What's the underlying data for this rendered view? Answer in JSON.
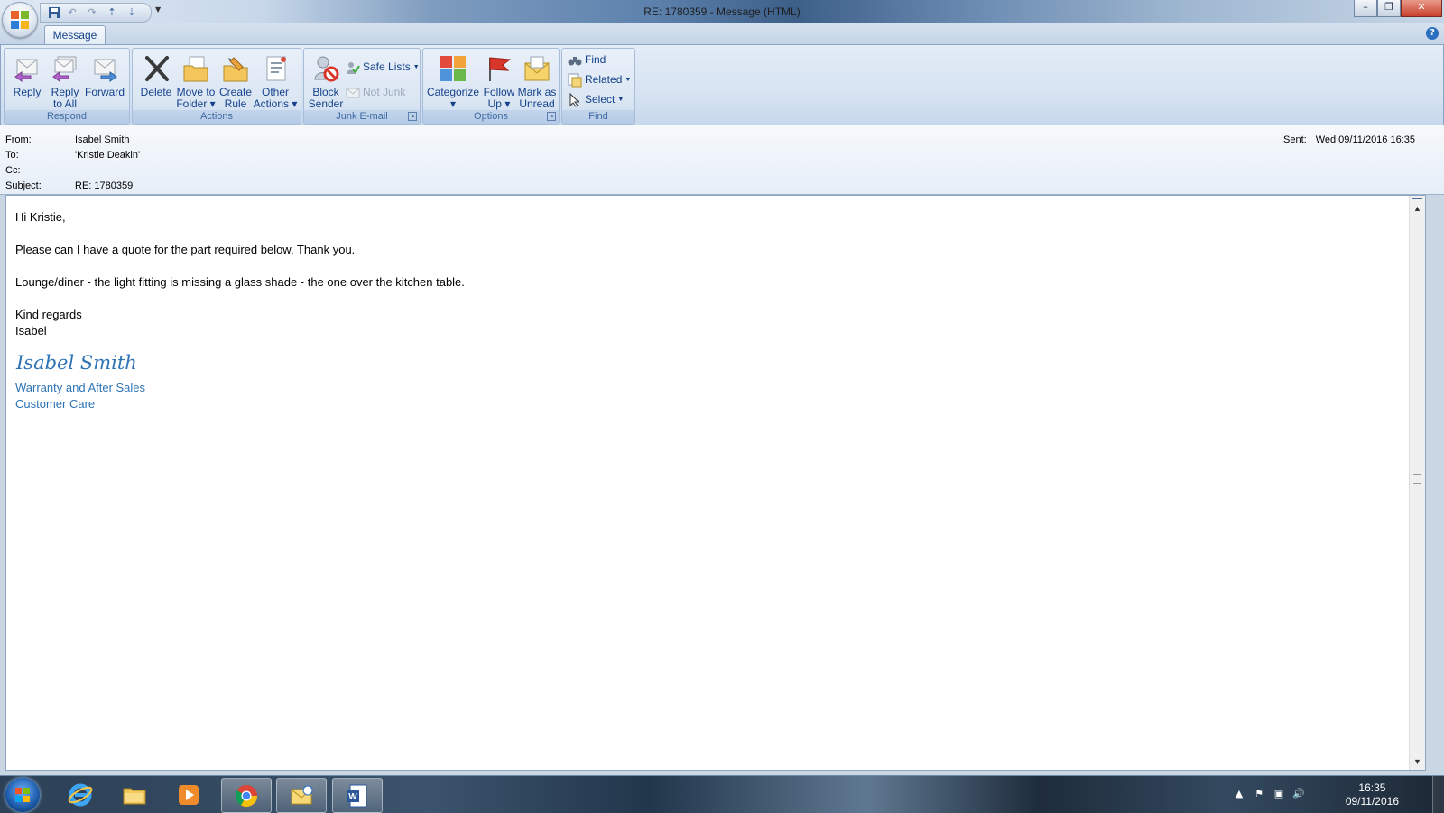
{
  "window": {
    "title": "RE: 1780359  -  Message (HTML)",
    "controls": [
      "–",
      "❐",
      "✕"
    ]
  },
  "ribbon": {
    "tab": "Message",
    "groups": {
      "respond": {
        "label": "Respond",
        "reply": "Reply",
        "reply_all": "Reply\nto All",
        "forward": "Forward"
      },
      "actions": {
        "label": "Actions",
        "delete": "Delete",
        "move_to_folder": "Move to\nFolder ▾",
        "create_rule": "Create\nRule",
        "other_actions": "Other\nActions ▾"
      },
      "junk": {
        "label": "Junk E-mail",
        "block_sender": "Block\nSender",
        "safe_lists": "Safe Lists",
        "not_junk": "Not Junk"
      },
      "options": {
        "label": "Options",
        "categorize": "Categorize\n▾",
        "follow_up": "Follow\nUp ▾",
        "mark_unread": "Mark as\nUnread"
      },
      "find": {
        "label": "Find",
        "find": "Find",
        "related": "Related",
        "select": "Select"
      }
    }
  },
  "header": {
    "from_label": "From:",
    "from": "Isabel Smith",
    "to_label": "To:",
    "to": "'Kristie Deakin'",
    "cc_label": "Cc:",
    "cc": "",
    "subject_label": "Subject:",
    "subject": "RE: 1780359",
    "sent_label": "Sent:",
    "sent": "Wed 09/11/2016 16:35"
  },
  "body": {
    "greeting": "Hi Kristie,",
    "line1": "Please can I have a quote for the part required below. Thank you.",
    "line2": "Lounge/diner - the light fitting is missing a glass shade - the one over the kitchen table.",
    "closing": "Kind regards",
    "sender_first": "Isabel",
    "signature_name": "Isabel Smith",
    "signature_dept": "Warranty and After Sales",
    "signature_team": "Customer Care"
  },
  "taskbar": {
    "time": "16:35",
    "date": "09/11/2016"
  },
  "colors": {
    "ribbon_text": "#15428b",
    "signature": "#2e74b5",
    "accent": "#8ba4c3"
  }
}
